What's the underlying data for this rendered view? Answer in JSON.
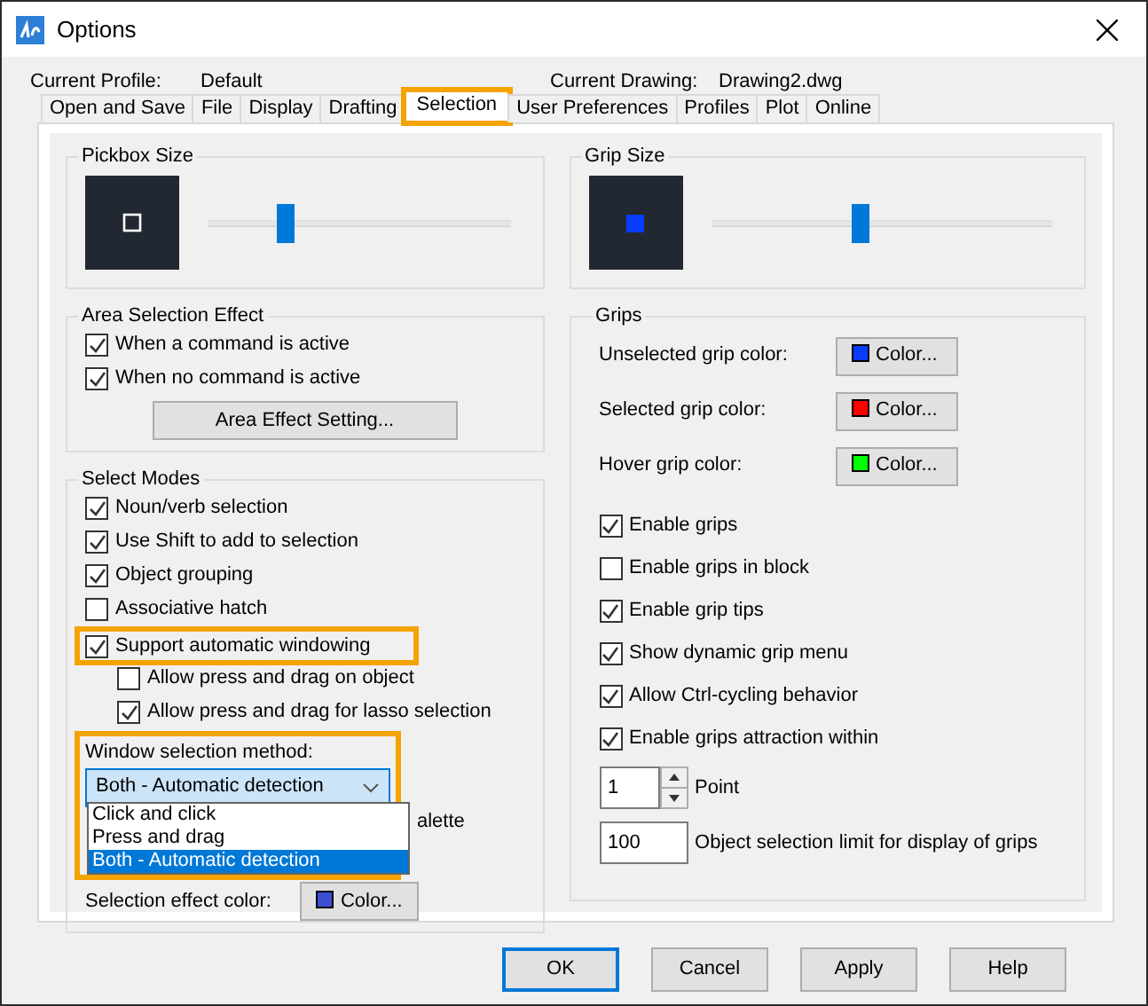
{
  "window": {
    "title": "Options"
  },
  "profile": {
    "label": "Current Profile:",
    "value": "Default"
  },
  "drawing": {
    "label": "Current Drawing:",
    "value": "Drawing2.dwg"
  },
  "tabs": [
    {
      "label": "Open and Save",
      "selected": false,
      "highlighted": false
    },
    {
      "label": "File",
      "selected": false,
      "highlighted": false
    },
    {
      "label": "Display",
      "selected": false,
      "highlighted": false
    },
    {
      "label": "Drafting",
      "selected": false,
      "highlighted": false
    },
    {
      "label": "Selection",
      "selected": true,
      "highlighted": true
    },
    {
      "label": "User Preferences",
      "selected": false,
      "highlighted": false
    },
    {
      "label": "Profiles",
      "selected": false,
      "highlighted": false
    },
    {
      "label": "Plot",
      "selected": false,
      "highlighted": false
    },
    {
      "label": "Online",
      "selected": false,
      "highlighted": false
    }
  ],
  "pickbox": {
    "title": "Pickbox Size",
    "level": 0.26
  },
  "grip_size": {
    "title": "Grip Size",
    "level": 0.44
  },
  "area_selection": {
    "title": "Area Selection Effect",
    "options": [
      {
        "label": "When a command is active",
        "checked": true
      },
      {
        "label": "When no command is active",
        "checked": true
      }
    ],
    "button": "Area Effect Setting..."
  },
  "select_modes": {
    "title": "Select Modes",
    "options": [
      {
        "label": "Noun/verb selection",
        "checked": true,
        "highlighted": false
      },
      {
        "label": "Use Shift to add to selection",
        "checked": true,
        "highlighted": false
      },
      {
        "label": "Object grouping",
        "checked": true,
        "highlighted": false
      },
      {
        "label": "Associative hatch",
        "checked": false,
        "highlighted": false
      },
      {
        "label": "Support automatic windowing",
        "checked": true,
        "highlighted": true,
        "children": [
          {
            "label": "Allow press and drag on object",
            "checked": false,
            "highlighted": false
          },
          {
            "label": "Allow press and drag for lasso selection",
            "checked": true,
            "highlighted": false
          }
        ]
      }
    ],
    "window_selection": {
      "label": "Window selection method:",
      "value": "Both - Automatic detection",
      "highlighted": true,
      "expanded": true,
      "options": [
        {
          "label": "Click and click",
          "selected": false
        },
        {
          "label": "Press and drag",
          "selected": false
        },
        {
          "label": "Both - Automatic detection",
          "selected": true
        }
      ]
    },
    "palette_fragment": "alette",
    "selection_effect": {
      "label": "Selection effect color:",
      "button": "Color...",
      "color": "#3c4fd0"
    }
  },
  "grips": {
    "title": "Grips",
    "colors": [
      {
        "label": "Unselected grip color:",
        "button": "Color...",
        "color": "#0a3cff"
      },
      {
        "label": "Selected grip color:",
        "button": "Color...",
        "color": "#ff0000"
      },
      {
        "label": "Hover grip color:",
        "button": "Color...",
        "color": "#00ff00"
      }
    ],
    "options": [
      {
        "label": "Enable grips",
        "checked": true
      },
      {
        "label": "Enable grips in block",
        "checked": false
      },
      {
        "label": "Enable grip tips",
        "checked": true
      },
      {
        "label": "Show dynamic grip menu",
        "checked": true
      },
      {
        "label": "Allow Ctrl-cycling behavior",
        "checked": true
      },
      {
        "label": "Enable grips attraction within",
        "checked": true
      }
    ],
    "spinner": {
      "value": "1",
      "label": "Point"
    },
    "limit": {
      "value": "100",
      "label": "Object selection limit for display of grips"
    }
  },
  "buttons": [
    {
      "label": "OK",
      "default": true
    },
    {
      "label": "Cancel",
      "default": false
    },
    {
      "label": "Apply",
      "default": false
    },
    {
      "label": "Help",
      "default": false
    }
  ]
}
